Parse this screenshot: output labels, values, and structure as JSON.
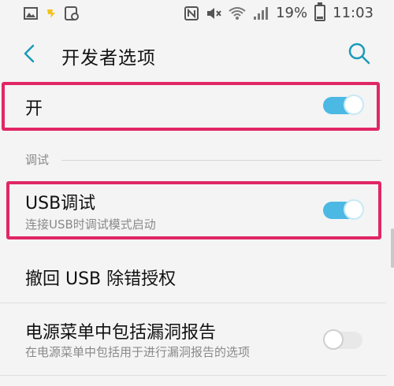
{
  "status_bar": {
    "battery": "19%",
    "time": "11:03",
    "icons": [
      "gallery-icon",
      "weather-icon",
      "screenshot-icon",
      "nfc-icon",
      "mute-icon",
      "wifi-icon",
      "signal-icon",
      "battery-icon"
    ]
  },
  "header": {
    "title": "开发者选项",
    "back_icon": "back-arrow-icon",
    "search_icon": "search-icon"
  },
  "master_switch": {
    "label": "开",
    "enabled": true
  },
  "section": {
    "label": "调试"
  },
  "settings": [
    {
      "title": "USB调试",
      "subtitle": "连接USB时调试模式启动",
      "toggle": true,
      "highlighted": true
    },
    {
      "title": "撤回 USB 除错授权",
      "subtitle": "",
      "toggle": null,
      "highlighted": false
    },
    {
      "title": "电源菜单中包括漏洞报告",
      "subtitle": "在电源菜单中包括用于进行漏洞报告的选项",
      "toggle": false,
      "highlighted": false
    }
  ],
  "colors": {
    "accent": "#4cb8e4",
    "highlight": "#e02766",
    "back_arrow": "#1a9ab8"
  }
}
